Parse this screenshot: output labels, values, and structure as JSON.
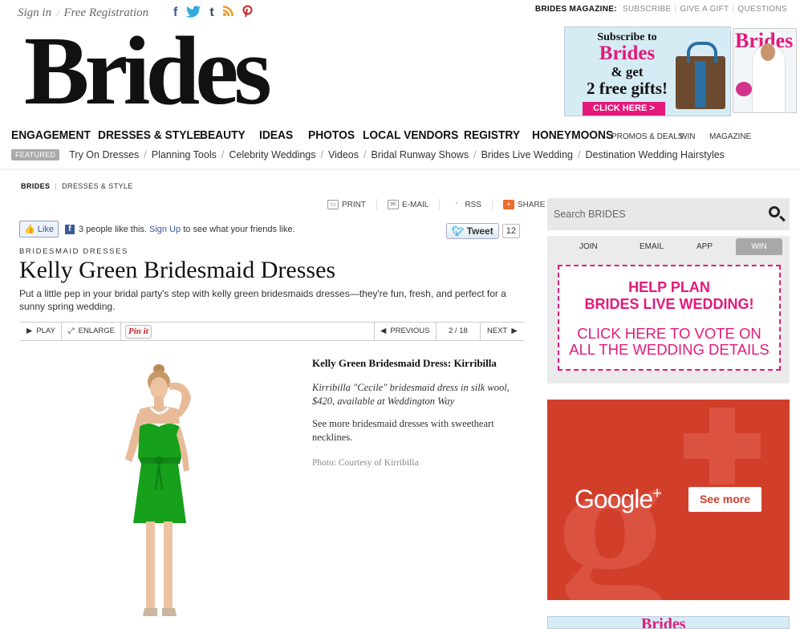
{
  "topbar": {
    "sign_in": "Sign in",
    "register": "Free Registration",
    "social": [
      "facebook-icon",
      "twitter-icon",
      "tumblr-icon",
      "rss-icon",
      "pinterest-icon"
    ],
    "mag_label": "BRIDES MAGAZINE:",
    "subscribe": "SUBSCRIBE",
    "give_gift": "GIVE A GIFT",
    "questions": "QUESTIONS"
  },
  "logo": "Brides",
  "promo": {
    "line1": "Subscribe to",
    "line2": "Brides",
    "line3": "& get",
    "line4": "2 free gifts!",
    "cta": "CLICK HERE >",
    "cover_mast": "Brides"
  },
  "nav": {
    "items": [
      "ENGAGEMENT",
      "DRESSES & STYLE",
      "BEAUTY",
      "IDEAS",
      "PHOTOS",
      "LOCAL VENDORS",
      "REGISTRY",
      "HONEYMOONS"
    ],
    "small_items": [
      "PROMOS & DEALS",
      "WIN",
      "MAGAZINE"
    ],
    "featured_label": "FEATURED",
    "featured": [
      "Try On Dresses",
      "Planning Tools",
      "Celebrity Weddings",
      "Videos",
      "Bridal Runway Shows",
      "Brides Live Wedding",
      "Destination Wedding Hairstyles"
    ]
  },
  "breadcrumb": [
    "BRIDES",
    "DRESSES & STYLE"
  ],
  "tools": [
    "PRINT",
    "E-MAIL",
    "RSS",
    "SHARE"
  ],
  "social_bar": {
    "like": "Like",
    "like_text_pre": "3 people like this.",
    "signup": "Sign Up",
    "like_text_post": "to see what your friends like.",
    "tweet": "Tweet",
    "tweet_count": "12"
  },
  "article": {
    "kicker": "BRIDESMAID DRESSES",
    "title": "Kelly Green Bridesmaid Dresses",
    "dek": "Put a little pep in your bridal party's step with kelly green bridesmaids dresses—they're fun, fresh, and perfect for a sunny spring wedding."
  },
  "gallery": {
    "play": "PLAY",
    "enlarge": "ENLARGE",
    "pin": "Pin it",
    "previous": "PREVIOUS",
    "counter": "2 / 18",
    "next": "NEXT"
  },
  "caption": {
    "heading": "Kelly Green Bridesmaid Dress: Kirribilla",
    "description": "Kirribilla \"Cecile\" bridesmaid dress in silk wool, $420, available at Weddington Way",
    "more": "See more bridesmaid dresses with sweetheart necklines.",
    "credit": "Photo: Courtesy of Kirribilla"
  },
  "sidebar": {
    "search_placeholder": "Search BRIDES",
    "tabs": [
      "JOIN",
      "EMAIL",
      "APP",
      "WIN"
    ],
    "vote_line1": "HELP PLAN",
    "vote_line2": "BRIDES LIVE WEDDING!",
    "vote_line3": "CLICK HERE TO VOTE ON",
    "vote_line4": "ALL THE WEDDING DETAILS",
    "gplus_word": "Google",
    "gplus_plus": "+",
    "gplus_cta": "See more",
    "bottom_ad": "Brides"
  },
  "colors": {
    "brand_pink": "#e4197b",
    "dress_green": "#17a01b",
    "google_red": "#d13f2b"
  }
}
